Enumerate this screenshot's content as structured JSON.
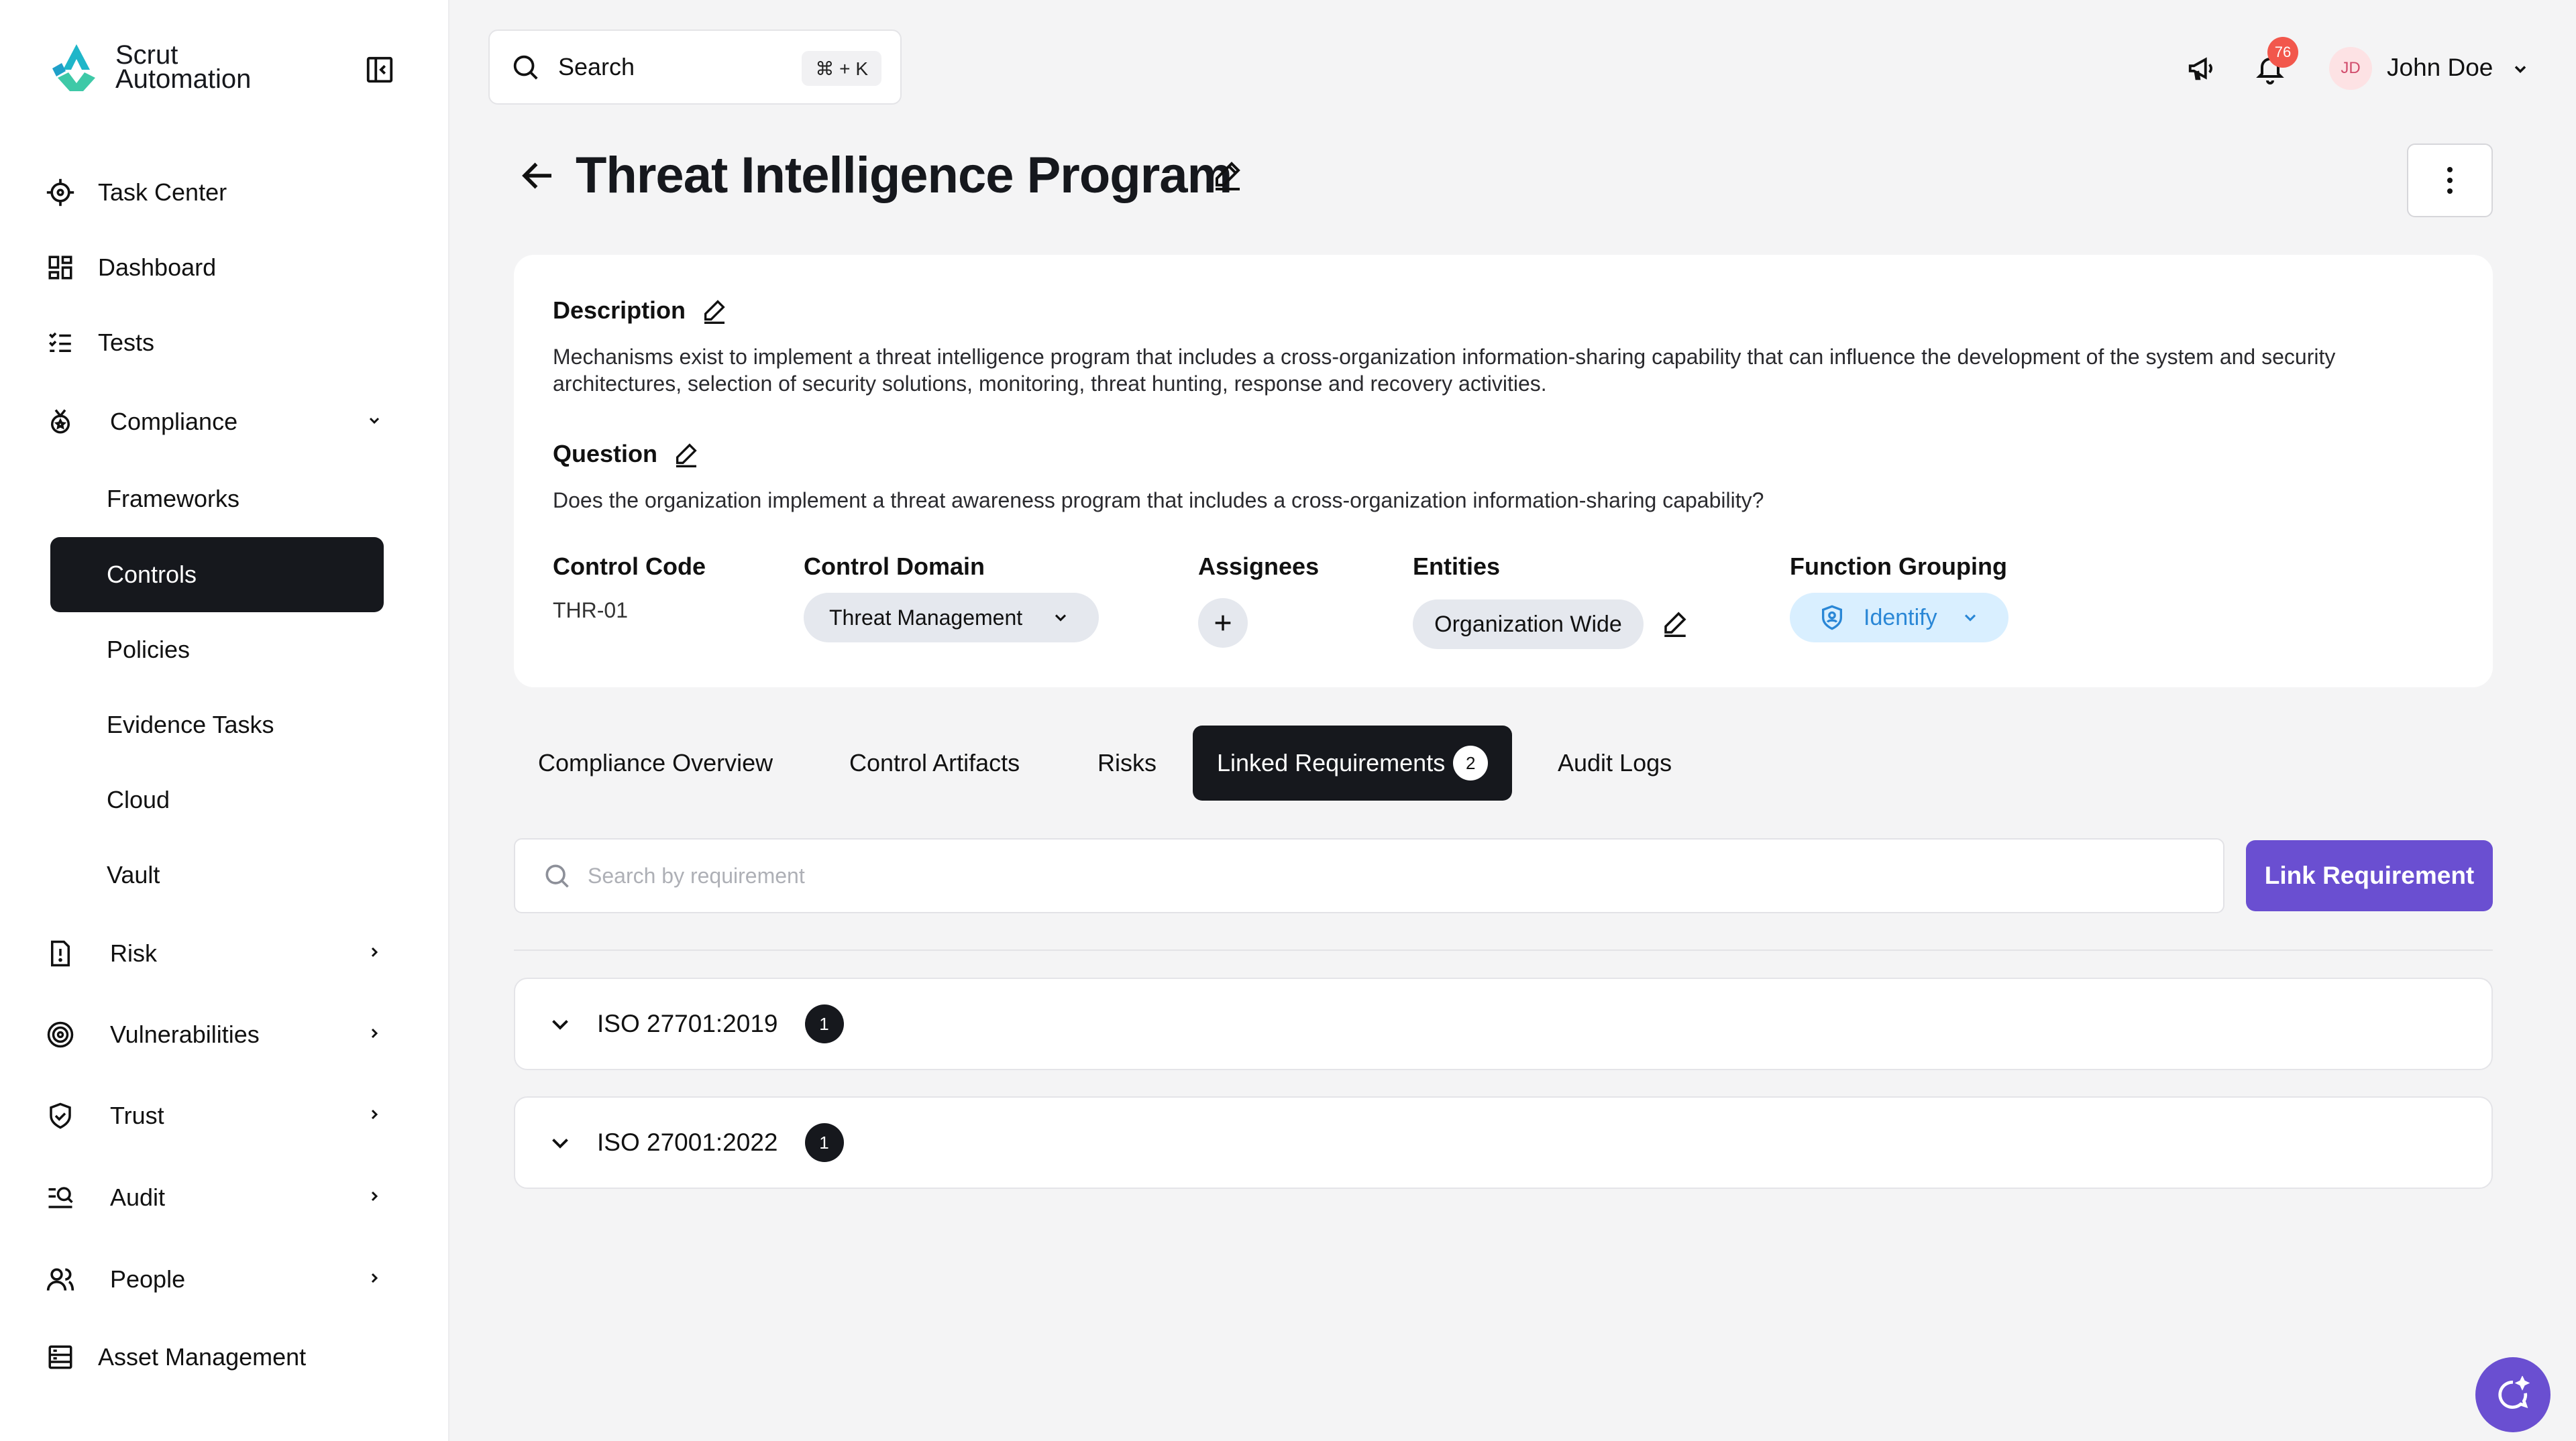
{
  "app": {
    "logo_line1": "Scrut",
    "logo_line2": "Automation",
    "brand_colors": {
      "accent": "#6a4fd1",
      "dark": "#16181d",
      "logo_teal": "#1fb6c9",
      "badge": "#f2574c"
    }
  },
  "sidebar": {
    "items": [
      {
        "label": "Task Center",
        "icon": "crosshair-icon"
      },
      {
        "label": "Dashboard",
        "icon": "dashboard-grid-icon"
      },
      {
        "label": "Tests",
        "icon": "checklist-icon"
      },
      {
        "label": "Compliance",
        "icon": "medal-icon"
      },
      {
        "label": "Risk",
        "icon": "alert-file-icon"
      },
      {
        "label": "Vulnerabilities",
        "icon": "target-icon"
      },
      {
        "label": "Trust",
        "icon": "shield-check-icon"
      },
      {
        "label": "Audit",
        "icon": "search-list-icon"
      },
      {
        "label": "People",
        "icon": "users-icon"
      },
      {
        "label": "Asset Management",
        "icon": "server-icon"
      }
    ],
    "compliance_sub": [
      {
        "label": "Frameworks"
      },
      {
        "label": "Controls"
      },
      {
        "label": "Policies"
      },
      {
        "label": "Evidence Tasks"
      },
      {
        "label": "Cloud"
      },
      {
        "label": "Vault"
      }
    ]
  },
  "topbar": {
    "search_label": "Search",
    "shortcut": "⌘ + K",
    "notifications_count": "76",
    "user_initials": "JD",
    "user_name": "John Doe"
  },
  "page": {
    "title": "Threat Intelligence Program"
  },
  "details": {
    "description_label": "Description",
    "description_text": "Mechanisms exist to implement a threat intelligence program that includes a cross-organization information-sharing capability that can influence the development of the system and security architectures, selection of security solutions, monitoring, threat hunting, response and recovery activities.",
    "question_label": "Question",
    "question_text": "Does the organization implement a threat awareness program that includes a cross-organization information-sharing capability?",
    "control_code_label": "Control Code",
    "control_code": "THR-01",
    "control_domain_label": "Control Domain",
    "control_domain": "Threat Management",
    "assignees_label": "Assignees",
    "entities_label": "Entities",
    "entities": "Organization Wide",
    "function_grouping_label": "Function Grouping",
    "function_grouping": "Identify"
  },
  "tabs": [
    {
      "label": "Compliance Overview"
    },
    {
      "label": "Control Artifacts"
    },
    {
      "label": "Risks"
    },
    {
      "label": "Linked Requirements",
      "count": "2"
    },
    {
      "label": "Audit Logs"
    }
  ],
  "requirements": {
    "search_placeholder": "Search by requirement",
    "link_button": "Link Requirement",
    "rows": [
      {
        "name": "ISO 27701:2019",
        "count": "1"
      },
      {
        "name": "ISO 27001:2022",
        "count": "1"
      }
    ]
  }
}
